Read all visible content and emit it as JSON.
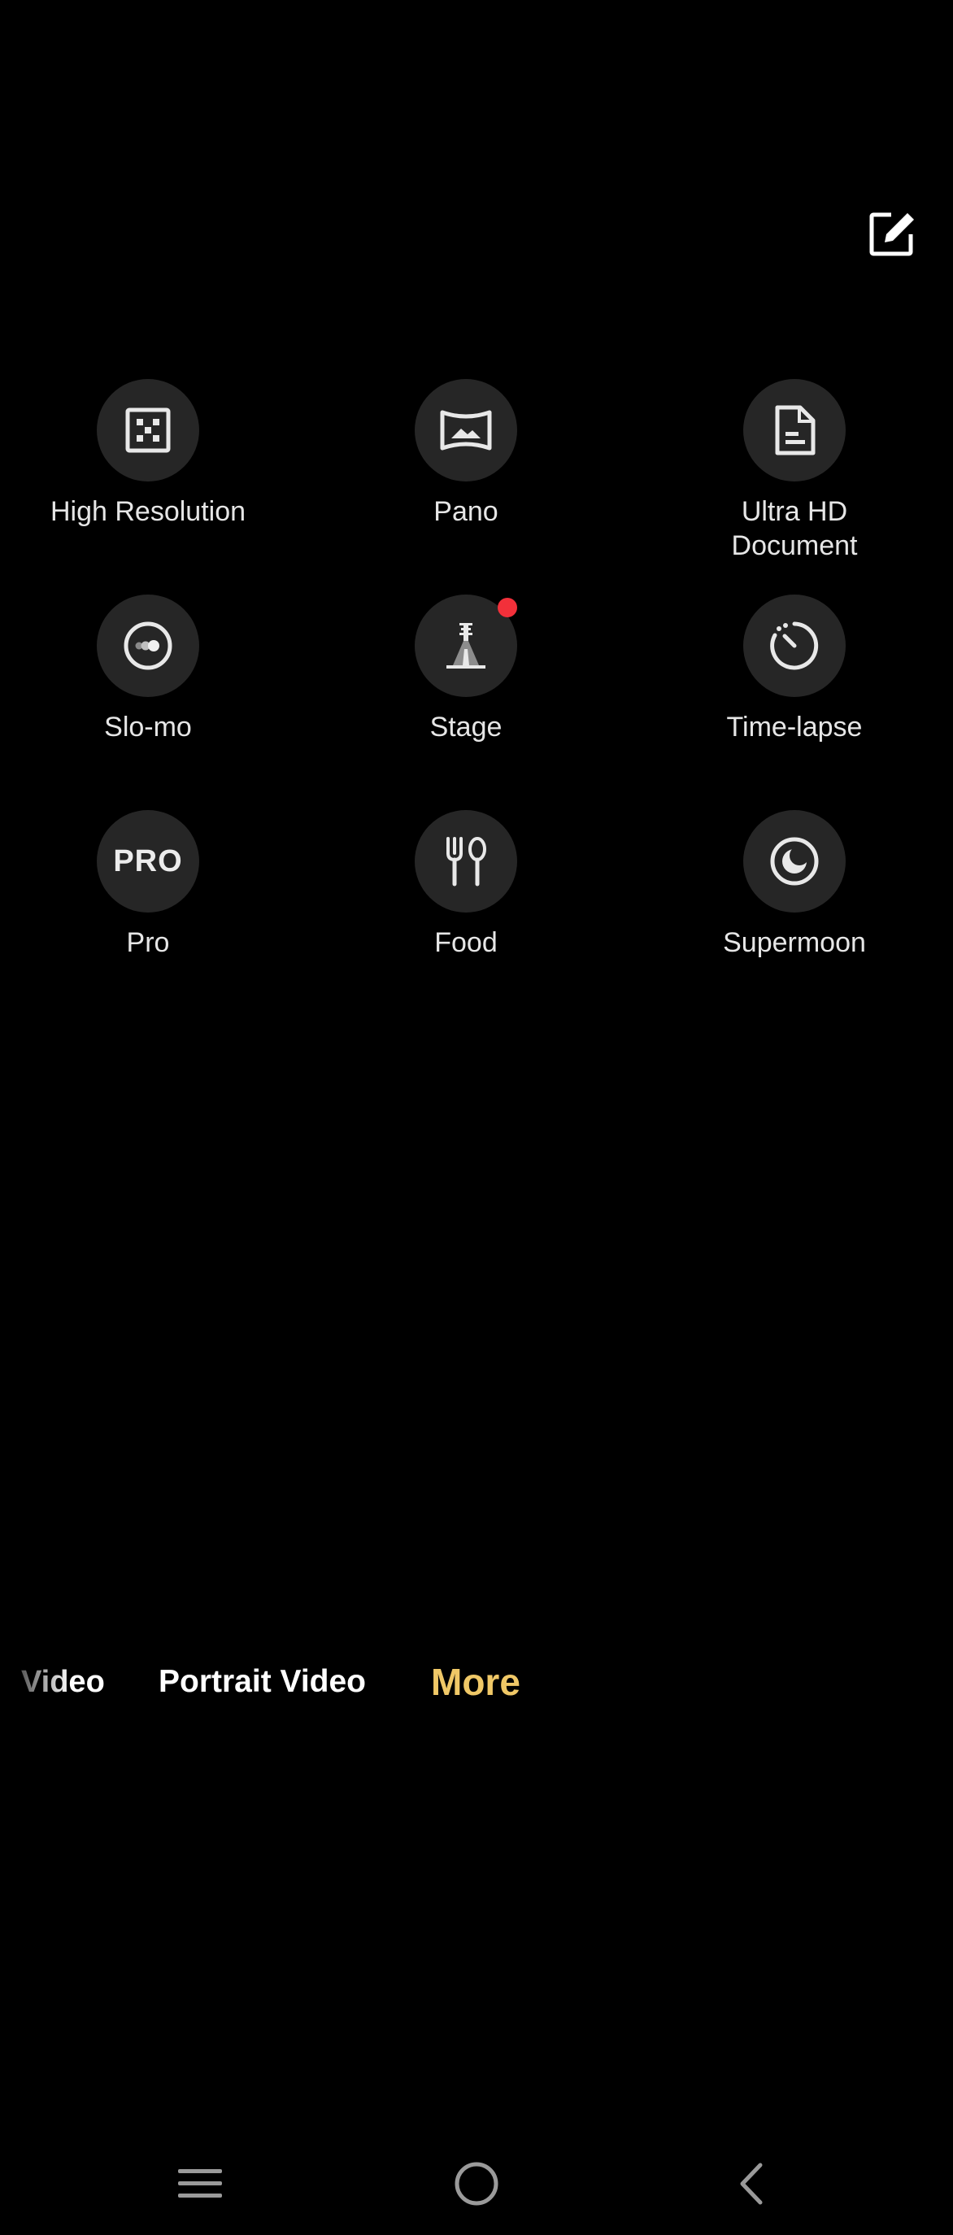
{
  "modes": [
    {
      "id": "high-resolution",
      "label": "High Resolution",
      "icon": "high-resolution-icon",
      "badge": false
    },
    {
      "id": "pano",
      "label": "Pano",
      "icon": "pano-icon",
      "badge": false
    },
    {
      "id": "ultra-hd-document",
      "label": "Ultra HD\nDocument",
      "icon": "document-icon",
      "badge": false
    },
    {
      "id": "slo-mo",
      "label": "Slo-mo",
      "icon": "slo-mo-icon",
      "badge": false
    },
    {
      "id": "stage",
      "label": "Stage",
      "icon": "stage-spotlight-icon",
      "badge": true
    },
    {
      "id": "time-lapse",
      "label": "Time-lapse",
      "icon": "time-lapse-icon",
      "badge": false
    },
    {
      "id": "pro",
      "label": "Pro",
      "icon": "pro-icon",
      "icon_text": "PRO",
      "badge": false
    },
    {
      "id": "food",
      "label": "Food",
      "icon": "fork-spoon-icon",
      "badge": false
    },
    {
      "id": "supermoon",
      "label": "Supermoon",
      "icon": "moon-icon",
      "badge": false
    }
  ],
  "mode_strip": {
    "video": "Video",
    "portrait_video": "Portrait Video",
    "more": "More"
  },
  "header": {
    "edit_icon": "edit-icon"
  },
  "nav": {
    "menu_icon": "menu-icon",
    "home_icon": "home-icon",
    "back_icon": "back-icon"
  },
  "colors": {
    "background": "#000000",
    "icon_circle": "#262626",
    "accent": "#f0c867",
    "badge": "#f2303a"
  }
}
